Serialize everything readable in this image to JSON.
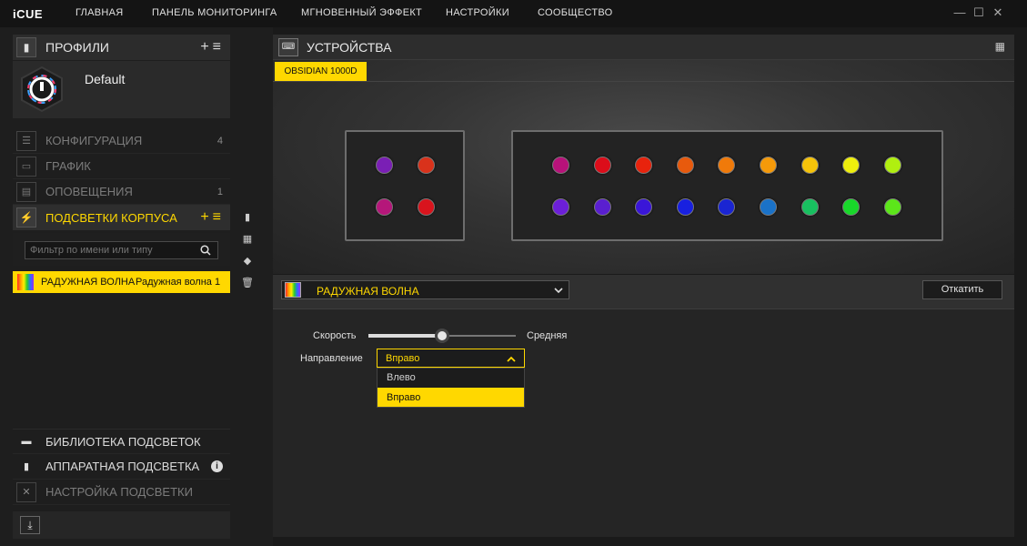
{
  "app": {
    "name": "iCUE"
  },
  "nav": {
    "home": "ГЛАВНАЯ",
    "monitor": "ПАНЕЛЬ МОНИТОРИНГА",
    "instant": "МГНОВЕННЫЙ ЭФФЕКТ",
    "settings": "НАСТРОЙКИ",
    "community": "СООБЩЕСТВО"
  },
  "window": {
    "minimize": "—",
    "maximize": "☐",
    "close": "✕"
  },
  "profiles": {
    "title": "ПРОФИЛИ",
    "current": "Default"
  },
  "menu": {
    "config": {
      "label": "КОНФИГУРАЦИЯ",
      "count": "4"
    },
    "graph": {
      "label": "ГРАФИК"
    },
    "alerts": {
      "label": "ОПОВЕЩЕНИЯ",
      "count": "1"
    },
    "lighting": {
      "label": "ПОДСВЕТКИ КОРПУСА"
    }
  },
  "filter": {
    "placeholder": "Фильтр по имени или типу"
  },
  "effect_list": [
    {
      "name": "РАДУЖНАЯ ВОЛНА",
      "value": "Радужная волна 1"
    }
  ],
  "bottom_menu": {
    "library": "БИБЛИОТЕКА ПОДСВЕТОК",
    "hardware": "АППАРАТНАЯ ПОДСВЕТКА",
    "setup": "НАСТРОЙКА ПОДСВЕТКИ"
  },
  "devices": {
    "title": "УСТРОЙСТВА",
    "tab": "OBSIDIAN 1000D"
  },
  "led_colors": {
    "left_top": [
      "#7a1fb5",
      "#d9321b"
    ],
    "left_bottom": [
      "#b5177a",
      "#d9141d"
    ],
    "right_top": [
      "#b8127a",
      "#dc0d1a",
      "#e8230d",
      "#e85a0d",
      "#f07a0a",
      "#f59a0a",
      "#f5c30a",
      "#eeee0d",
      "#b0ef10"
    ],
    "right_bottom": [
      "#6c1fd8",
      "#5a1fd0",
      "#3a16d8",
      "#1820e0",
      "#1a25d2",
      "#1a72c8",
      "#18c060",
      "#18d82a",
      "#5ce61a"
    ]
  },
  "effect": {
    "selected": "РАДУЖНАЯ ВОЛНА",
    "revert": "Откатить"
  },
  "speed": {
    "label": "Скорость",
    "value": "Средняя",
    "level": 0.5
  },
  "direction": {
    "label": "Направление",
    "selected": "Вправо",
    "options": [
      "Влево",
      "Вправо"
    ]
  },
  "colors": {
    "accent": "#ffd800"
  }
}
